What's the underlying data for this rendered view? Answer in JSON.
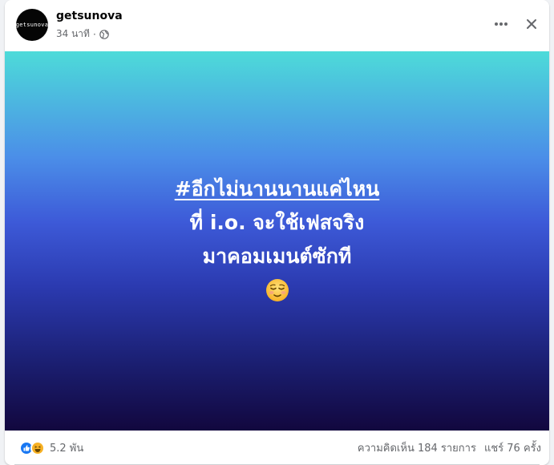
{
  "post": {
    "author": "getsunova",
    "avatar_text": "getsunova",
    "time": "34 นาที",
    "separator": "·",
    "privacy_icon": "globe-icon"
  },
  "media": {
    "hashtag": "#อีกไม่นานนานแค่ไหน",
    "line1": "ที่ i.o. จะใช้เฟสจริง",
    "line2": "มาคอมเมนต์ซักที",
    "emoji": "relieved-face",
    "gradient_top": "#4ddbd9",
    "gradient_bottom": "#12073e"
  },
  "footer": {
    "reaction_count": "5.2 พัน",
    "comments": "ความคิดเห็น 184 รายการ",
    "shares": "แชร์ 76 ครั้ง"
  },
  "colors": {
    "like_blue": "#1877f2",
    "haha_yellow": "#f7b125",
    "secondary_text": "#65676b"
  }
}
